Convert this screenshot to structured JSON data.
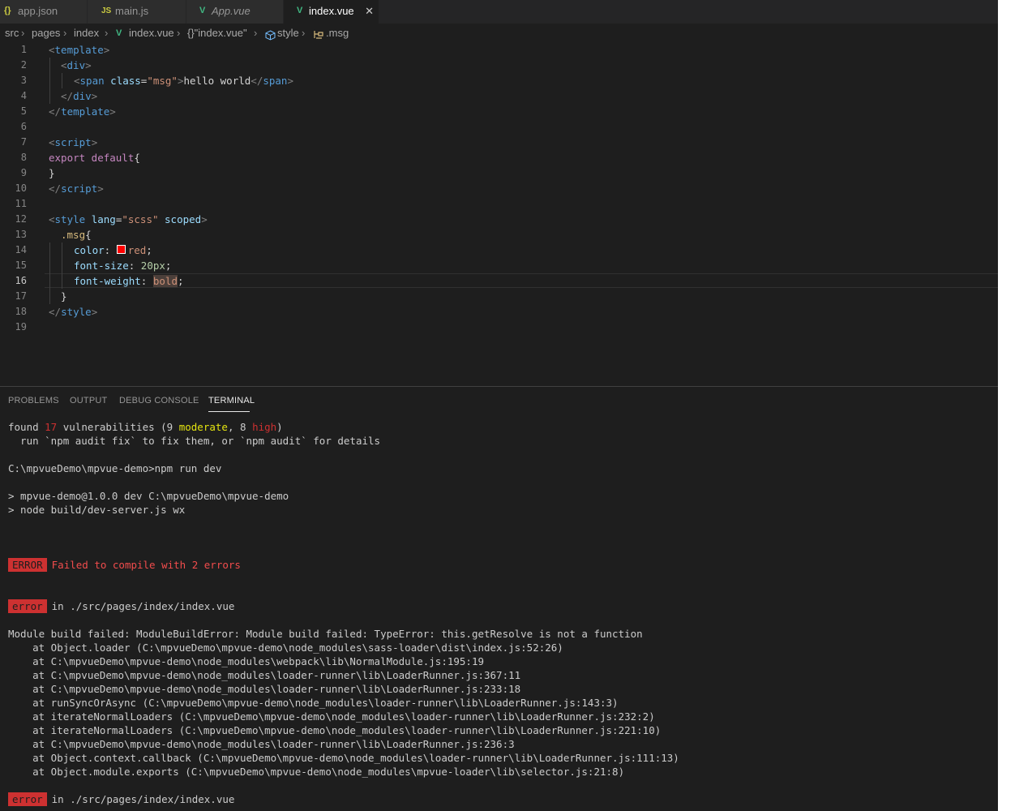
{
  "tabs": [
    {
      "icon": "{}",
      "label": "app.json"
    },
    {
      "icon": "JS",
      "label": "main.js"
    },
    {
      "icon": "V",
      "label": "App.vue"
    },
    {
      "icon": "V",
      "label": "index.vue",
      "close": "✕"
    }
  ],
  "breadcrumb": [
    "src",
    "pages",
    "index",
    "index.vue",
    "{}\"index.vue\"",
    "style",
    ".msg"
  ],
  "breadcrumb_sep": "›",
  "editor": {
    "line_numbers": [
      "1",
      "2",
      "3",
      "4",
      "5",
      "6",
      "7",
      "8",
      "9",
      "10",
      "11",
      "12",
      "13",
      "14",
      "15",
      "16",
      "17",
      "18",
      "19"
    ],
    "code": {
      "l1_open": "<",
      "l1_tag": "template",
      "l1_close": ">",
      "l2_open": "<",
      "l2_tag": "div",
      "l2_close": ">",
      "l3_open": "<",
      "l3_tag": "span",
      "l3_attr": " class",
      "l3_eq": "=",
      "l3_str": "\"msg\"",
      "l3_gt": ">",
      "l3_text": "hello world",
      "l3_end_open": "</",
      "l3_end_tag": "span",
      "l3_end_close": ">",
      "l4_open": "</",
      "l4_tag": "div",
      "l4_close": ">",
      "l5_open": "</",
      "l5_tag": "template",
      "l5_close": ">",
      "l7_open": "<",
      "l7_tag": "script",
      "l7_close": ">",
      "l8_kw1": "export",
      "l8_kw2": " default",
      "l8_brace": "{",
      "l9_brace": "}",
      "l10_open": "</",
      "l10_tag": "script",
      "l10_close": ">",
      "l12_open": "<",
      "l12_tag": "style",
      "l12_attr1": " lang",
      "l12_eq": "=",
      "l12_str": "\"scss\"",
      "l12_attr2": " scoped",
      "l12_close": ">",
      "l13_sel": ".msg",
      "l13_brace": "{",
      "l14_prop": "color",
      "l14_colon": ": ",
      "l14_val": "red",
      "l14_semi": ";",
      "l15_prop": "font-size",
      "l15_colon": ": ",
      "l15_num": "20px",
      "l15_semi": ";",
      "l16_prop": "font-weight",
      "l16_colon": ": ",
      "l16_val_a": "bol",
      "l16_val_b": "d",
      "l16_semi": ";",
      "l17_brace": "}",
      "l18_open": "</",
      "l18_tag": "style",
      "l18_close": ">"
    }
  },
  "panel": {
    "tabs": [
      "PROBLEMS",
      "OUTPUT",
      "DEBUG CONSOLE",
      "TERMINAL"
    ],
    "active_tab": "TERMINAL"
  },
  "terminal": {
    "l1_a": "found ",
    "l1_num": "17",
    "l1_b": " vulnerabilities (9 ",
    "l1_mod": "moderate",
    "l1_c": ", 8 ",
    "l1_high": "high",
    "l1_d": ")",
    "l2": "  run `npm audit fix` to fix them, or `npm audit` for details",
    "l3": "C:\\mpvueDemo\\mpvue-demo>npm run dev",
    "l4": "> mpvue-demo@1.0.0 dev C:\\mpvueDemo\\mpvue-demo",
    "l5": "> node build/dev-server.js wx",
    "error_badge": "ERROR",
    "error_msg": "Failed to compile with 2 errors",
    "err_badge": "error",
    "err_in": "in ./src/pages/index/index.vue",
    "module_failed": "Module build failed: ModuleBuildError: Module build failed: TypeError: this.getResolve is not a function",
    "stack": [
      "    at Object.loader (C:\\mpvueDemo\\mpvue-demo\\node_modules\\sass-loader\\dist\\index.js:52:26)",
      "    at C:\\mpvueDemo\\mpvue-demo\\node_modules\\webpack\\lib\\NormalModule.js:195:19",
      "    at C:\\mpvueDemo\\mpvue-demo\\node_modules\\loader-runner\\lib\\LoaderRunner.js:367:11",
      "    at C:\\mpvueDemo\\mpvue-demo\\node_modules\\loader-runner\\lib\\LoaderRunner.js:233:18",
      "    at runSyncOrAsync (C:\\mpvueDemo\\mpvue-demo\\node_modules\\loader-runner\\lib\\LoaderRunner.js:143:3)",
      "    at iterateNormalLoaders (C:\\mpvueDemo\\mpvue-demo\\node_modules\\loader-runner\\lib\\LoaderRunner.js:232:2)",
      "    at iterateNormalLoaders (C:\\mpvueDemo\\mpvue-demo\\node_modules\\loader-runner\\lib\\LoaderRunner.js:221:10)",
      "    at C:\\mpvueDemo\\mpvue-demo\\node_modules\\loader-runner\\lib\\LoaderRunner.js:236:3",
      "    at Object.context.callback (C:\\mpvueDemo\\mpvue-demo\\node_modules\\loader-runner\\lib\\LoaderRunner.js:111:13)",
      "    at Object.module.exports (C:\\mpvueDemo\\mpvue-demo\\node_modules\\mpvue-loader\\lib\\selector.js:21:8)"
    ],
    "err2_badge": "error",
    "err2_in": "in ./src/pages/index/index.vue"
  }
}
